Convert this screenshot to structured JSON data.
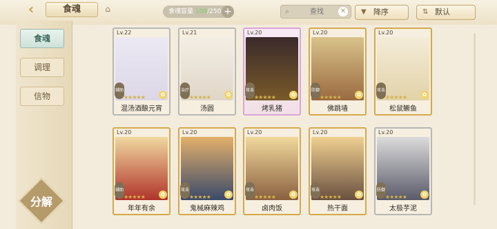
{
  "header": {
    "title": "食魂",
    "capacity_label": "食魂容量",
    "capacity_value": "108",
    "capacity_total": "/250",
    "capacity_add": "+",
    "search_placeholder": "查找",
    "sort_label": "降序",
    "default_label": "默认"
  },
  "sidebar": {
    "items": [
      {
        "label": "食魂"
      },
      {
        "label": "调理"
      },
      {
        "label": "信物"
      }
    ],
    "decompose_label": "分解"
  },
  "cards": [
    {
      "level": "Lv.22",
      "name": "混汤酒酿元宵",
      "badge": "辅助",
      "stars": "★★★★★"
    },
    {
      "level": "Lv.21",
      "name": "汤圆",
      "badge": "治疗",
      "stars": "★★★★★"
    },
    {
      "level": "Lv.20",
      "name": "烤乳猪",
      "badge": "攻击",
      "stars": "★★★★★"
    },
    {
      "level": "Lv.20",
      "name": "佛跳墙",
      "badge": "防御",
      "stars": "★★★★★"
    },
    {
      "level": "Lv.20",
      "name": "松鼠鳜鱼",
      "badge": "攻击",
      "stars": "★★★★★"
    },
    {
      "level": "Lv.20",
      "name": "年年有余",
      "badge": "辅助",
      "stars": "★★★★★"
    },
    {
      "level": "Lv.20",
      "name": "鬼械麻辣鸡",
      "badge": "攻击",
      "stars": "★★★★★"
    },
    {
      "level": "Lv.20",
      "name": "卤肉饭",
      "badge": "攻击",
      "stars": "★★★★★"
    },
    {
      "level": "Lv.20",
      "name": "热干面",
      "badge": "攻击",
      "stars": "★★★★★"
    },
    {
      "level": "Lv.20",
      "name": "太极芋泥",
      "badge": "防御",
      "stars": "★★★★★"
    }
  ],
  "colors": {
    "background": "#f3ecdc",
    "gold": "#c99b3f",
    "sp_border": "#d9a4d9"
  }
}
